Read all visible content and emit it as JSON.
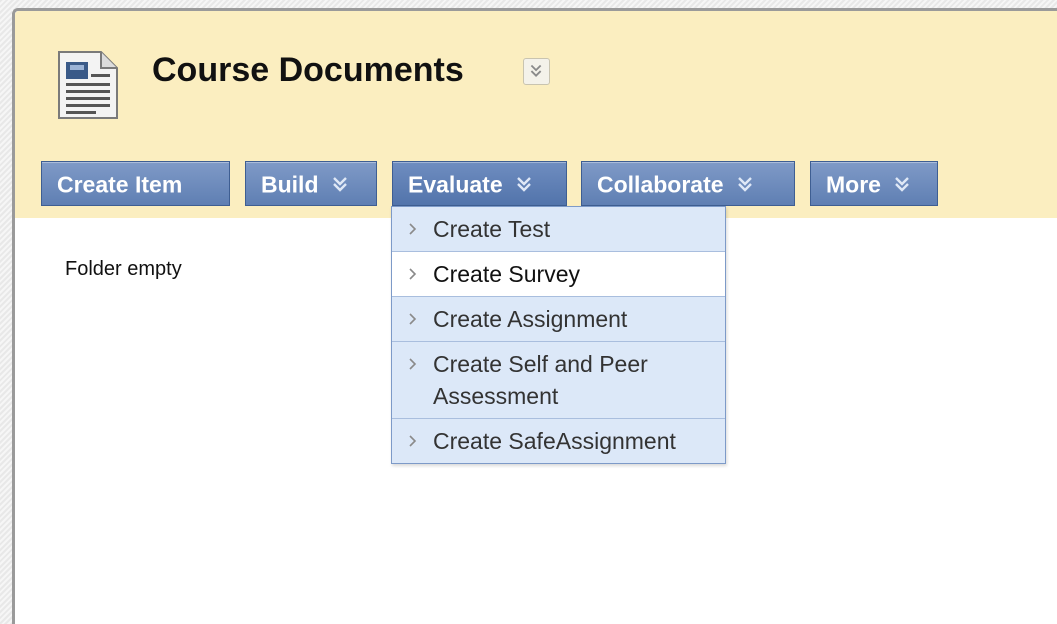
{
  "page": {
    "title": "Course Documents",
    "empty_message": "Folder empty"
  },
  "toolbar": {
    "buttons": [
      {
        "label": "Create Item",
        "has_menu": false
      },
      {
        "label": "Build",
        "has_menu": true
      },
      {
        "label": "Evaluate",
        "has_menu": true,
        "active": true
      },
      {
        "label": "Collaborate",
        "has_menu": true
      },
      {
        "label": "More",
        "has_menu": true
      }
    ]
  },
  "evaluate_menu": {
    "items": [
      {
        "label": "Create Test"
      },
      {
        "label": "Create Survey",
        "hovered": true
      },
      {
        "label": "Create Assignment"
      },
      {
        "label": "Create Self and Peer Assessment"
      },
      {
        "label": "Create SafeAssignment"
      }
    ]
  },
  "icons": {
    "page_icon": "document-icon",
    "title_menu": "double-chevron-down-icon",
    "button_menu": "double-chevron-down-icon",
    "menu_item": "chevron-right-icon"
  },
  "colors": {
    "header_bg": "#fbeec0",
    "button_bg": "#6a89bd",
    "menu_bg": "#dce8f8",
    "menu_hover_bg": "#ffffff"
  }
}
